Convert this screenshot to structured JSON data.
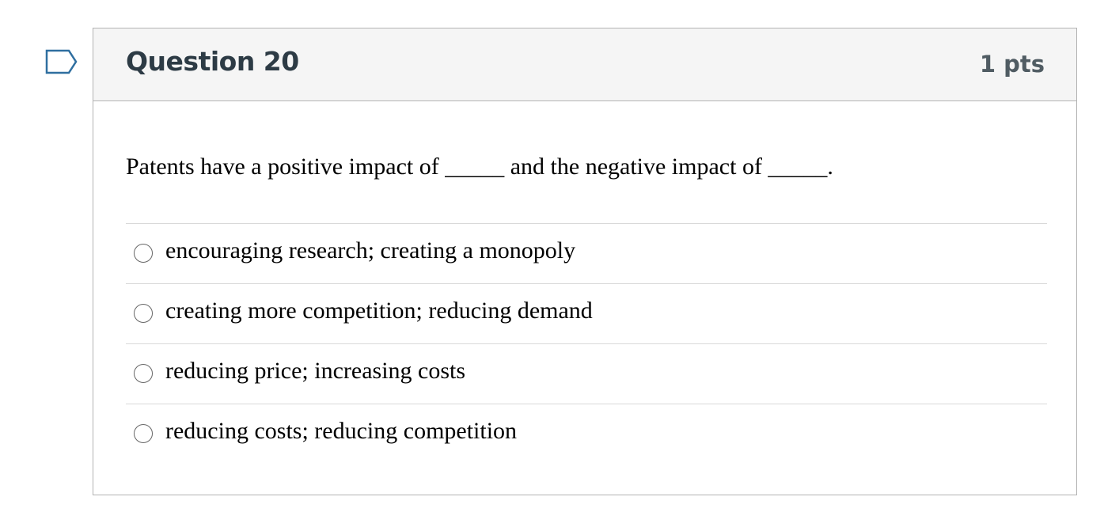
{
  "question": {
    "title": "Question 20",
    "points": "1 pts",
    "text": "Patents have a positive impact of _____ and the negative impact of _____."
  },
  "answers": [
    "encouraging research; creating a monopoly",
    "creating more competition; reducing demand",
    "reducing price; increasing costs",
    "reducing costs; reducing competition"
  ],
  "colors": {
    "flag_stroke": "#2f6fa0",
    "header_bg": "#f5f5f5",
    "border": "#b3b3b3"
  },
  "icons": {
    "flag": "flag-question-icon"
  }
}
